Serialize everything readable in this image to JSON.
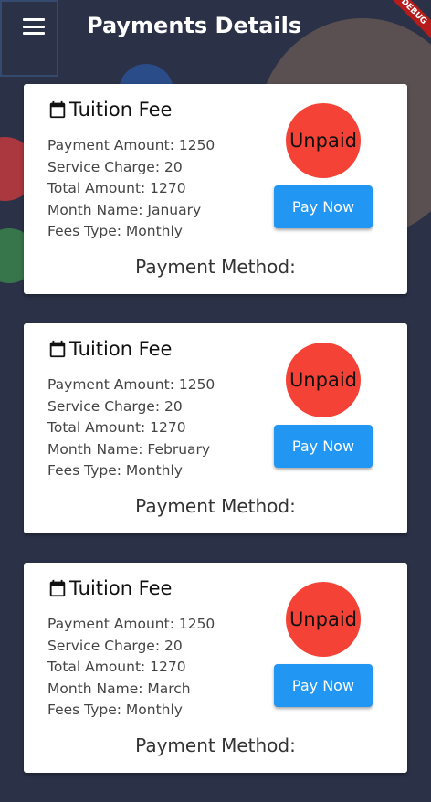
{
  "appbar": {
    "title": "Payments Details",
    "banner": "DEBUG"
  },
  "cards": [
    {
      "title": "Tuition Fee",
      "lines": [
        "Payment Amount: 1250",
        "Service Charge: 20",
        "Total Amount: 1270",
        "Month Name:  January",
        "Fees Type: Monthly"
      ],
      "status": "Unpaid",
      "button": "Pay Now",
      "method": "Payment Method:"
    },
    {
      "title": "Tuition Fee",
      "lines": [
        "Payment Amount: 1250",
        "Service Charge: 20",
        "Total Amount: 1270",
        "Month Name:  February",
        "Fees Type: Monthly"
      ],
      "status": "Unpaid",
      "button": "Pay Now",
      "method": "Payment Method:"
    },
    {
      "title": "Tuition Fee",
      "lines": [
        "Payment Amount: 1250",
        "Service Charge: 20",
        "Total Amount: 1270",
        "Month Name:  March",
        "Fees Type: Monthly"
      ],
      "status": "Unpaid",
      "button": "Pay Now",
      "method": "Payment Method:"
    }
  ],
  "colors": {
    "status_unpaid": "#f44336",
    "button": "#2196f3",
    "background": "#2b3247"
  }
}
